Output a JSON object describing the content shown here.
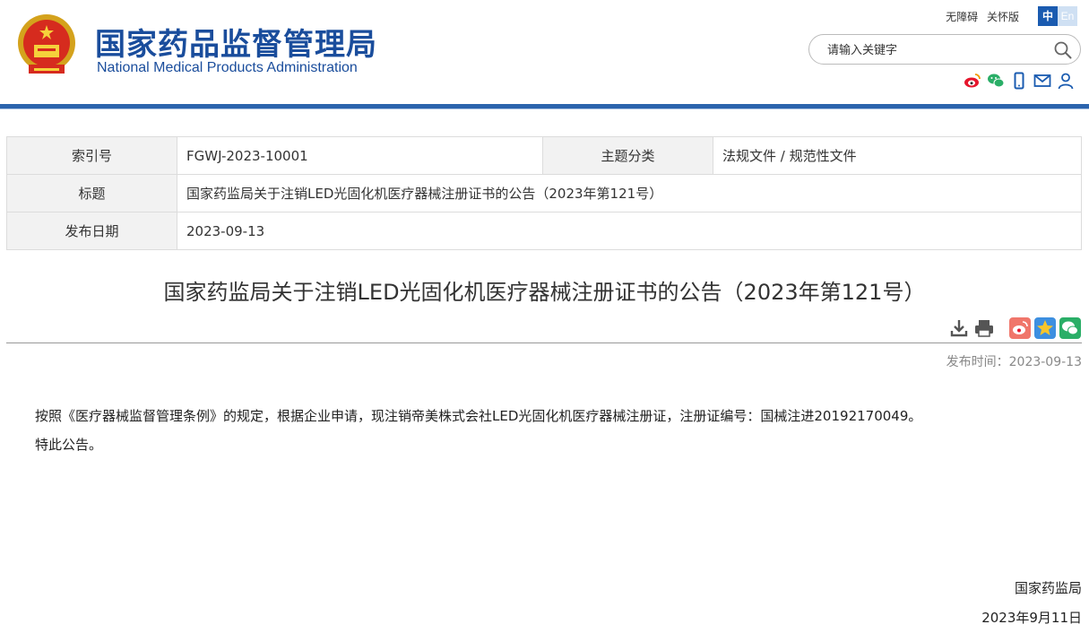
{
  "header": {
    "title_cn": "国家药品监督管理局",
    "title_en": "National Medical Products Administration",
    "links": {
      "accessibility": "无障碍",
      "elderly": "关怀版"
    },
    "lang": {
      "cn": "中",
      "en": "En"
    },
    "search": {
      "placeholder": "请输入关键字"
    },
    "social_icons": [
      "weibo-icon",
      "wechat-icon",
      "mobile-icon",
      "mail-icon",
      "user-icon"
    ]
  },
  "info_table": {
    "index_label": "索引号",
    "index_value": "FGWJ-2023-10001",
    "category_label": "主题分类",
    "category_value": "法规文件 / 规范性文件",
    "title_label": "标题",
    "title_value": "国家药监局关于注销LED光固化机医疗器械注册证书的公告（2023年第121号）",
    "date_label": "发布日期",
    "date_value": "2023-09-13"
  },
  "article": {
    "title": "国家药监局关于注销LED光固化机医疗器械注册证书的公告（2023年第121号）",
    "publish_time": "发布时间：2023-09-13",
    "paragraphs": [
      "按照《医疗器械监督管理条例》的规定，根据企业申请，现注销帝美株式会社LED光固化机医疗器械注册证，注册证编号：国械注进20192170049。",
      "特此公告。"
    ],
    "signature": "国家药监局",
    "sign_date": "2023年9月11日"
  },
  "colors": {
    "brand_blue": "#1a4d9c",
    "header_bar": "#2b64ad",
    "weibo_red": "#e6162d",
    "wechat_green": "#2aae67"
  }
}
